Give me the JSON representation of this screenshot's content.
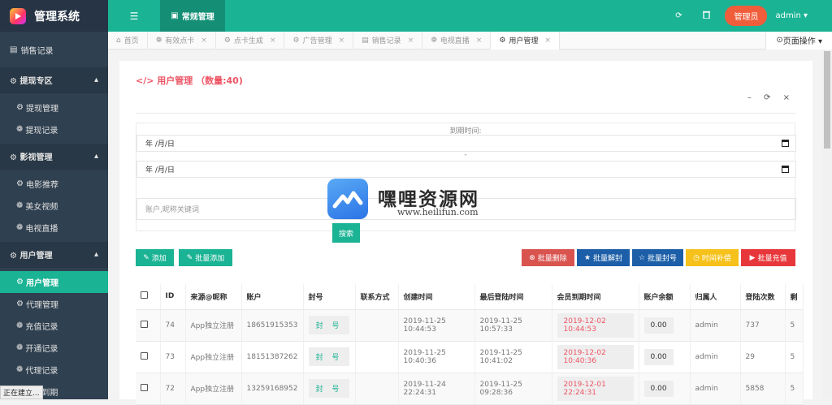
{
  "app": {
    "title": "管理系统",
    "logo_icon": "play-logo-icon"
  },
  "topbar": {
    "active_tab": "常规管理",
    "admin_button": "管理员",
    "user": "admin ▾",
    "refresh_icon": "⟳",
    "trash_icon": "🗑"
  },
  "sidebar": {
    "top_item": "销售记录",
    "groups": [
      {
        "label": "提现专区",
        "items": [
          "提现管理",
          "提现记录"
        ]
      },
      {
        "label": "影视管理",
        "items": [
          "电影推荐",
          "美女视频",
          "电视直播"
        ]
      },
      {
        "label": "用户管理",
        "items": [
          "用户管理",
          "代理管理",
          "充值记录",
          "开通记录",
          "代理记录",
          "即将到期"
        ]
      }
    ]
  },
  "status_text": "正在建立...",
  "tabs": [
    "首页",
    "有效点卡",
    "点卡生成",
    "广告管理",
    "销售记录",
    "电视直播",
    "用户管理"
  ],
  "page_ops": "页面操作 ▾",
  "content": {
    "title": "用户管理 （数量:40)",
    "tools": "– ⟳ ×",
    "date_label": "到期时间:",
    "date_placeholder": "年 /月/日",
    "dash": "-",
    "keyword_placeholder": "账户,昵称关键词",
    "search_btn": "搜索",
    "buttons": {
      "add": "添加",
      "batch_add": "批量添加",
      "batch_delete": "批量删除",
      "batch_unban": "批量解封",
      "batch_ban": "批量封号",
      "time_comp": "时间补偿",
      "batch_recharge": "批量充值"
    }
  },
  "watermark": {
    "title": "嘿哩资源网",
    "url": "www.heilifun.com"
  },
  "table": {
    "headers": [
      "",
      "ID",
      "来源@昵称",
      "账户",
      "封号",
      "联系方式",
      "创建时间",
      "最后登陆时间",
      "会员到期时间",
      "账户余额",
      "归属人",
      "登陆次数",
      "剩"
    ],
    "rows": [
      [
        "",
        "74",
        "App独立注册",
        "18651915353",
        "封 号",
        "",
        "2019-11-25 10:44:53",
        "2019-11-25 10:57:33",
        "2019-12-02 10:44:53",
        "0.00",
        "admin",
        "737",
        "5"
      ],
      [
        "",
        "73",
        "App独立注册",
        "18151387262",
        "封 号",
        "",
        "2019-11-25 10:40:36",
        "2019-11-25 10:41:02",
        "2019-12-02 10:40:36",
        "0.00",
        "admin",
        "29",
        "5"
      ],
      [
        "",
        "72",
        "App独立注册",
        "13259168952",
        "封 号",
        "",
        "2019-11-24 22:24:31",
        "2019-11-25 09:28:36",
        "2019-12-01 22:24:31",
        "0.00",
        "admin",
        "5858",
        "5"
      ]
    ]
  },
  "colors": {
    "primary": "#1ab394",
    "sidebar": "#2f4050",
    "danger": "#ed5565",
    "blue": "#1c84c6",
    "warning": "#f8ac59",
    "orange": "#f05d3a"
  }
}
